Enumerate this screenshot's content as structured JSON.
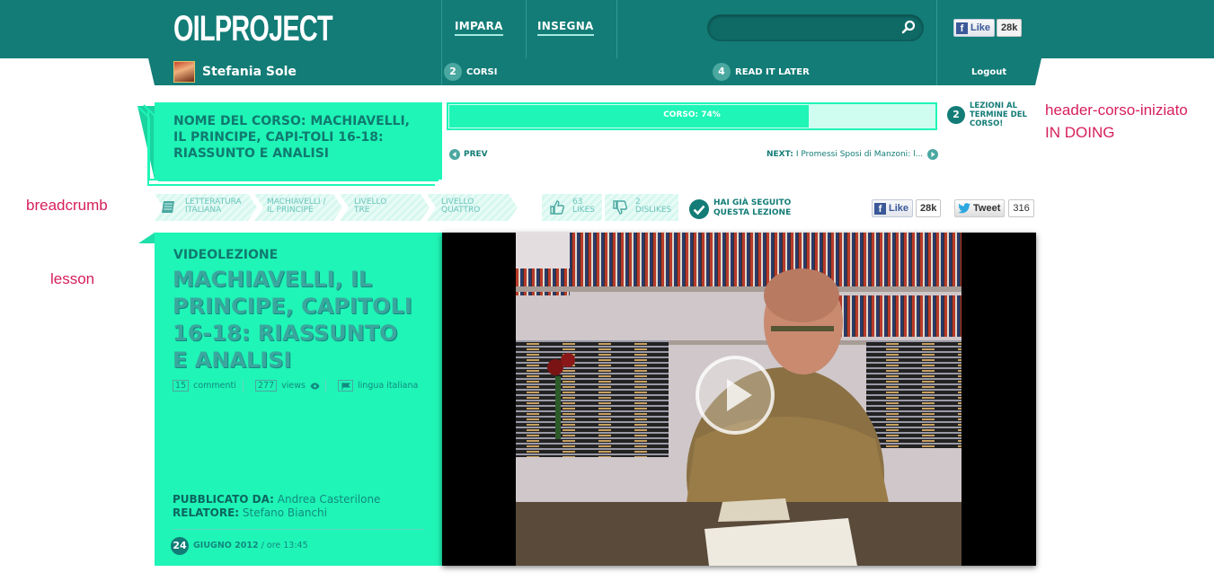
{
  "header": {
    "logo": "OILPROJECT",
    "nav": [
      {
        "label": "IMPARA"
      },
      {
        "label": "INSEGNA"
      }
    ],
    "search": {
      "placeholder": "",
      "value": ""
    },
    "fb_like": {
      "label": "Like",
      "count": "28k"
    }
  },
  "userbar": {
    "username": "Stefania Sole",
    "corsi_count": "2",
    "corsi_label": "CORSI",
    "read_later_count": "4",
    "read_later_label": "READ IT LATER",
    "logout": "Logout"
  },
  "course": {
    "title": "NOME DEL CORSO: MACHIAVELLI, IL PRINCIPE, CAPI-TOLI 16-18: RIASSUNTO E ANALISI",
    "progress_label": "CORSO: 74%",
    "progress": 0.74,
    "remaining_count": "2",
    "remaining_label": "LEZIONI AL TERMINE DEL CORSO!",
    "prev_label": "PREV",
    "next_label": "NEXT:",
    "next_title": "I Promessi Sposi di Manzoni: l..."
  },
  "breadcrumb": {
    "items": [
      {
        "line1": "LETTERATURA",
        "line2": "ITALIANA"
      },
      {
        "line1": "MACHIAVELLI /",
        "line2": "IL PRINCIPE"
      },
      {
        "line1": "LIVELLO",
        "line2": "TRE"
      },
      {
        "line1": "LIVELLO",
        "line2": "QUATTRO"
      }
    ],
    "likes_count": "63",
    "likes_label": "LIKES",
    "dislikes_count": "2",
    "dislikes_label": "DISLIKES",
    "followed_line1": "HAI GIÀ SEGUITO",
    "followed_line2": "QUESTA LEZIONE",
    "fb_like": {
      "label": "Like",
      "count": "28k"
    },
    "tweet": {
      "label": "Tweet",
      "count": "316"
    }
  },
  "lesson": {
    "kind": "VIDEOLEZIONE",
    "title": "MACHIAVELLI, IL PRINCIPE, CAPITOLI 16-18: RIASSUNTO E ANALISI",
    "comments_count": "15",
    "comments_label": "commenti",
    "views_count": "277",
    "views_label": "views",
    "language_label": "lingua italiana",
    "published_by_label": "PUBBLICATO DA:",
    "published_by": "Andrea Casterilone",
    "speaker_label": "RELATORE:",
    "speaker": "Stefano Bianchi",
    "day": "24",
    "month_year": "GIUGNO 2012",
    "time": "/ ore 13:45"
  },
  "annotations": {
    "header_course": "header-corso-iniziato",
    "doing": "IN DOING",
    "breadcrumb": "breadcrumb",
    "lesson": "lesson"
  },
  "colors": {
    "teal": "#137c77",
    "mint": "#1ff5b6",
    "annotation": "#d61f5a"
  }
}
